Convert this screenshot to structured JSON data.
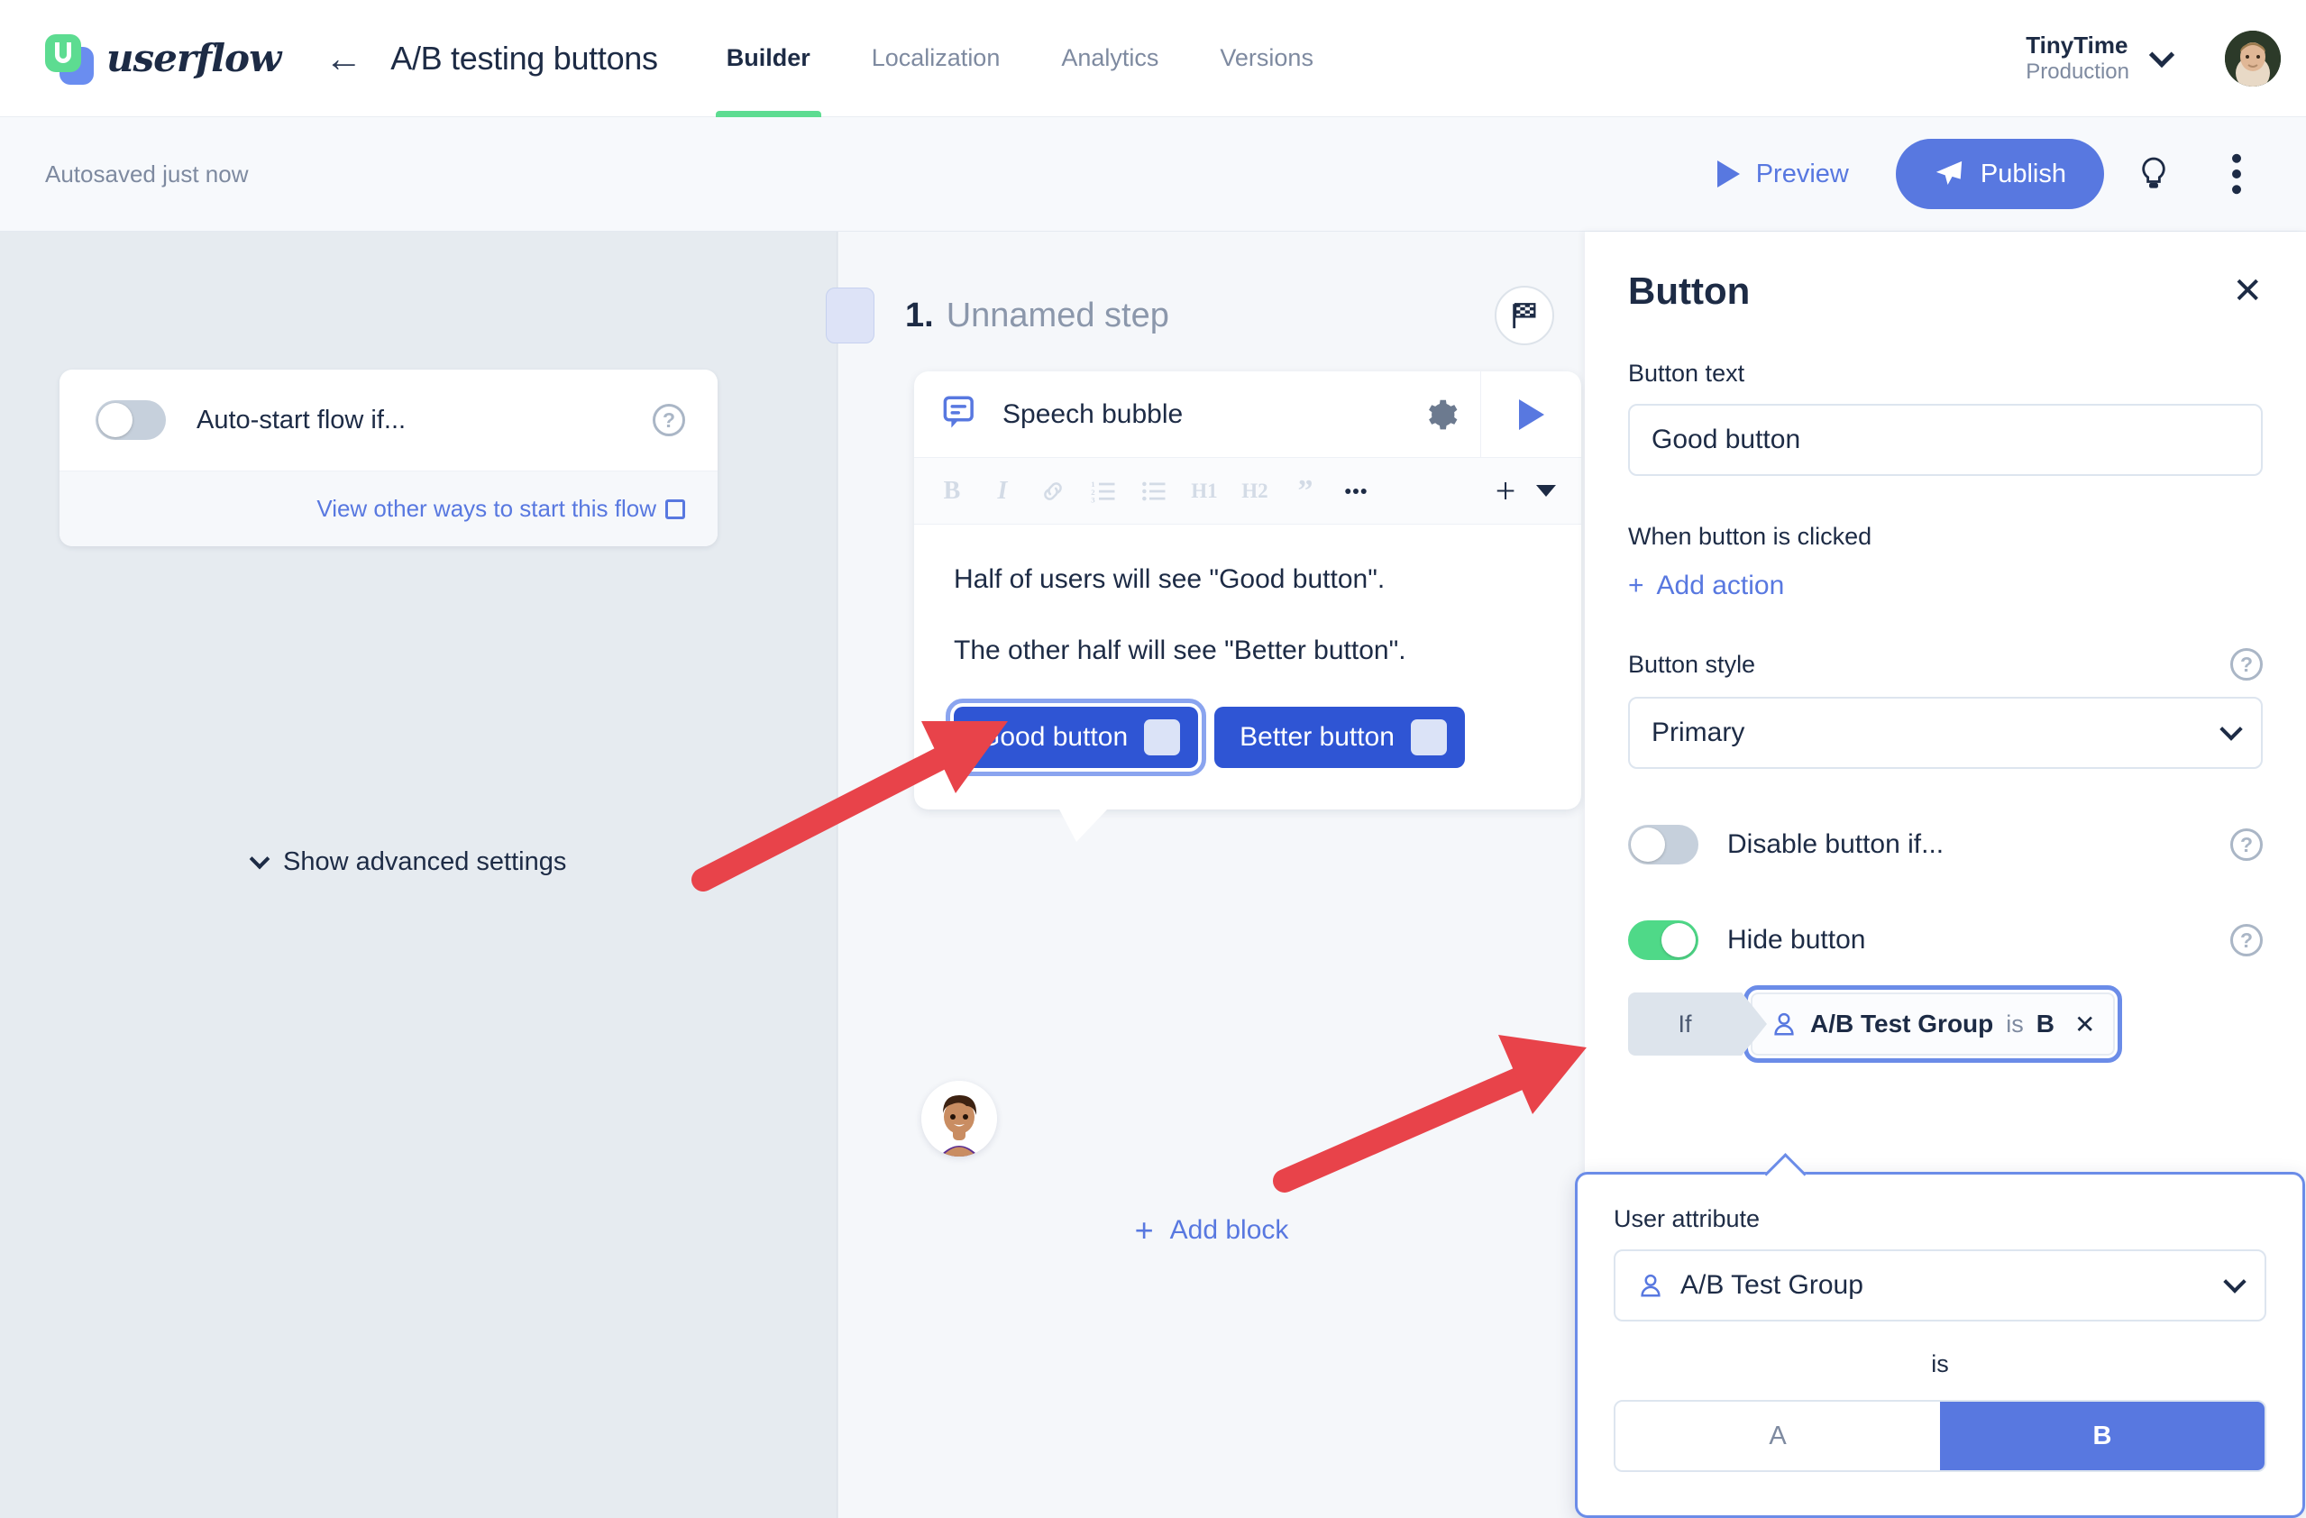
{
  "header": {
    "logo_text": "userflow",
    "logo_icon": "userflow-logo-icon",
    "back_icon": "back-arrow-icon",
    "doc_title": "A/B testing buttons",
    "tabs": [
      {
        "label": "Builder",
        "active": true
      },
      {
        "label": "Localization",
        "active": false
      },
      {
        "label": "Analytics",
        "active": false
      },
      {
        "label": "Versions",
        "active": false
      }
    ],
    "account": {
      "name": "TinyTime",
      "environment": "Production",
      "chevron_icon": "chevron-down-icon",
      "avatar_icon": "user-avatar"
    }
  },
  "subbar": {
    "autosave_text": "Autosaved just now",
    "preview_label": "Preview",
    "preview_icon": "play-icon",
    "publish_label": "Publish",
    "publish_icon": "paper-plane-icon",
    "hint_icon": "lightbulb-icon",
    "more_icon": "more-vertical-icon",
    "accent_color": "#5878e0"
  },
  "left_panel": {
    "auto_start_label": "Auto-start flow if...",
    "auto_start_enabled": false,
    "help_icon": "help-circle-icon",
    "view_other_ways_label": "View other ways to start this flow",
    "external_link_icon": "external-link-icon",
    "advanced_settings_label": "Show advanced settings",
    "advanced_chevron_icon": "chevron-down-icon"
  },
  "center": {
    "step_number": "1.",
    "step_name": "Unnamed step",
    "flag_icon": "checkered-flag-icon",
    "block": {
      "type_icon": "speech-bubble-icon",
      "type_label": "Speech bubble",
      "gear_icon": "gear-icon",
      "play_icon": "play-icon",
      "toolbar": [
        {
          "label": "B",
          "name": "bold-icon"
        },
        {
          "label": "I",
          "name": "italic-icon"
        },
        {
          "label": "link",
          "name": "link-icon"
        },
        {
          "label": "ol",
          "name": "ordered-list-icon"
        },
        {
          "label": "ul",
          "name": "bullet-list-icon"
        },
        {
          "label": "H1",
          "name": "heading-1-icon"
        },
        {
          "label": "H2",
          "name": "heading-2-icon"
        },
        {
          "label": "quote",
          "name": "blockquote-icon"
        },
        {
          "label": "more",
          "name": "more-horizontal-icon"
        }
      ],
      "plus_icon": "plus-icon",
      "plus_chevron_icon": "chevron-down-icon",
      "paragraph_1": "Half of users will see \"Good button\".",
      "paragraph_2": "The other half will see \"Better button\".",
      "buttons": [
        {
          "label": "Good button",
          "selected": true
        },
        {
          "label": "Better button",
          "selected": false
        }
      ],
      "button_color": "#2f55d4"
    },
    "persona_icon": "persona-avatar",
    "add_block_label": "Add block",
    "add_block_icon": "plus-icon"
  },
  "right_panel": {
    "title": "Button",
    "close_icon": "close-icon",
    "button_text_label": "Button text",
    "button_text_value": "Good button",
    "when_clicked_label": "When button is clicked",
    "add_action_label": "Add action",
    "add_action_icon": "plus-icon",
    "button_style_label": "Button style",
    "button_style_value": "Primary",
    "button_style_chevron_icon": "chevron-down-icon",
    "disable_label": "Disable button if...",
    "disable_enabled": false,
    "hide_label": "Hide button",
    "hide_enabled": true,
    "help_icon": "help-circle-icon",
    "condition": {
      "if_label": "If",
      "user_icon": "user-icon",
      "attribute": "A/B Test Group",
      "operator": "is",
      "value": "B",
      "remove_icon": "close-icon"
    },
    "toggle_on_color": "#4fd988"
  },
  "popover": {
    "label": "User attribute",
    "attribute_value": "A/B Test Group",
    "attribute_icon": "user-icon",
    "chevron_icon": "chevron-down-icon",
    "operator_label": "is",
    "options": [
      {
        "label": "A",
        "selected": false
      },
      {
        "label": "B",
        "selected": true
      }
    ],
    "border_color": "#6b8ce8",
    "selected_color": "#5878e0"
  },
  "annotations": {
    "arrow_color": "#e8434a",
    "arrow_1_target": "good-button-in-preview",
    "arrow_2_target": "hide-button-toggle"
  }
}
